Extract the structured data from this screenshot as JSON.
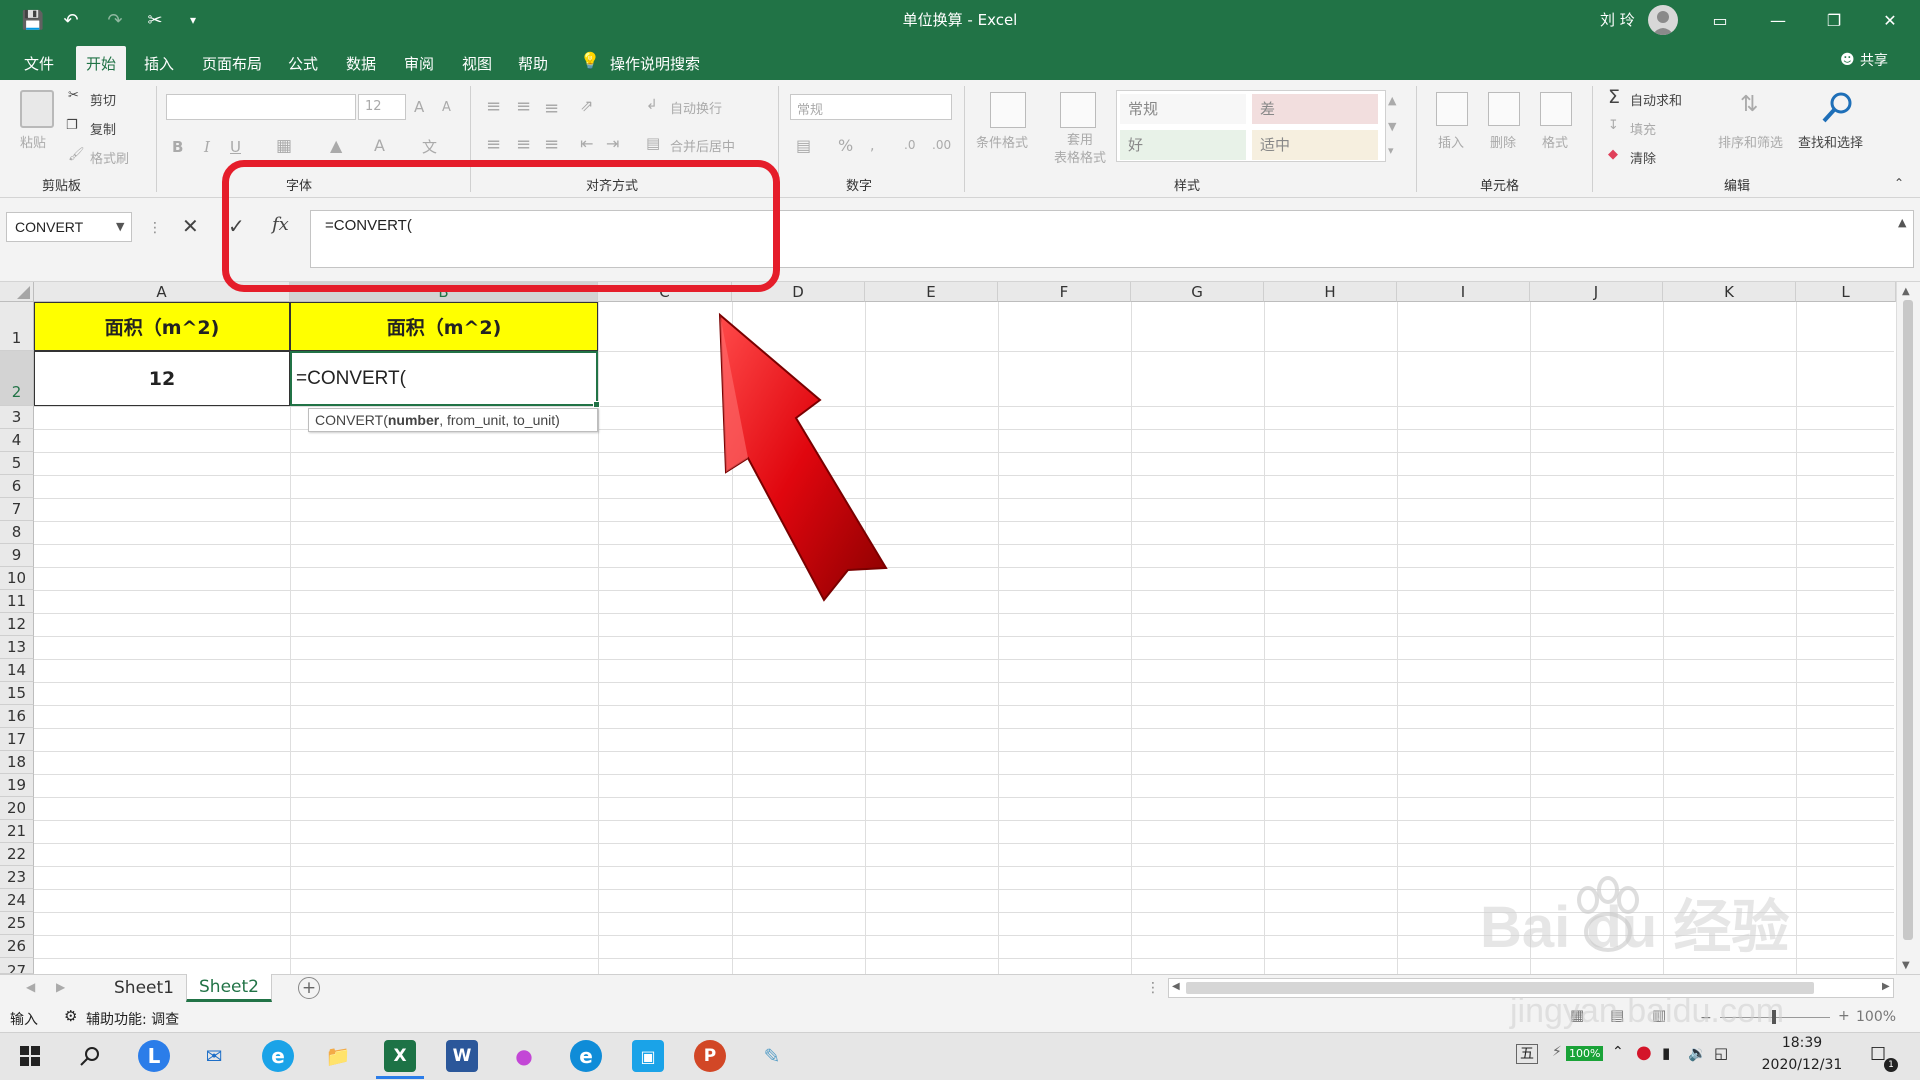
{
  "titlebar": {
    "title": "单位换算  -  Excel",
    "user_name": "刘 玲"
  },
  "ribbon_tabs": [
    "文件",
    "开始",
    "插入",
    "页面布局",
    "公式",
    "数据",
    "审阅",
    "视图",
    "帮助",
    "操作说明搜索"
  ],
  "share_label": "共享",
  "ribbon": {
    "clipboard": {
      "paste": "粘贴",
      "cut": "剪切",
      "copy": "复制",
      "format_painter": "格式刷",
      "label": "剪贴板"
    },
    "font": {
      "size": "12",
      "label": "字体"
    },
    "alignment": {
      "wrap": "自动换行",
      "merge": "合并后居中",
      "label": "对齐方式"
    },
    "number": {
      "format": "常规",
      "label": "数字"
    },
    "styles": {
      "conditional": "条件格式",
      "table": "套用\n表格格式",
      "normal": "常规",
      "bad": "差",
      "good": "好",
      "neutral": "适中",
      "label": "样式"
    },
    "cells": {
      "insert": "插入",
      "delete": "删除",
      "format": "格式",
      "label": "单元格"
    },
    "editing": {
      "autosum": "自动求和",
      "fill": "填充",
      "clear": "清除",
      "sort": "排序和筛选",
      "find": "查找和选择",
      "label": "编辑"
    }
  },
  "formula_bar": {
    "name_box": "CONVERT",
    "fx": "fx",
    "formula": "=CONVERT("
  },
  "columns": [
    "A",
    "B",
    "C",
    "D",
    "E",
    "F",
    "G",
    "H",
    "I",
    "J",
    "K",
    "L"
  ],
  "rows": [
    "1",
    "2",
    "3",
    "4",
    "5",
    "6",
    "7",
    "8",
    "9",
    "10",
    "11",
    "12",
    "13",
    "14",
    "15",
    "16",
    "17",
    "18",
    "19",
    "20",
    "21",
    "22",
    "23",
    "24",
    "25",
    "26",
    "27"
  ],
  "cells": {
    "A1": "面积（m^2)",
    "B1": "面积（m^2)",
    "A2": "12",
    "B2": "=CONVERT("
  },
  "tooltip": {
    "fn": "CONVERT(",
    "arg1": "number",
    "rest": ", from_unit, to_unit)"
  },
  "sheets": [
    "Sheet1",
    "Sheet2"
  ],
  "status": {
    "mode": "输入",
    "accessibility": "辅助功能: 调查",
    "zoom": "100%"
  },
  "taskbar": {
    "time": "18:39",
    "date": "2020/12/31",
    "battery": "100%",
    "ime": "五",
    "notifications": "1"
  },
  "watermark": {
    "brand": "Bai du 经验",
    "url": "jingyan.baidu.com"
  },
  "colors": {
    "excel_green": "#217346",
    "header_yellow": "#ffff00",
    "annotation_red": "#e51d2a"
  }
}
